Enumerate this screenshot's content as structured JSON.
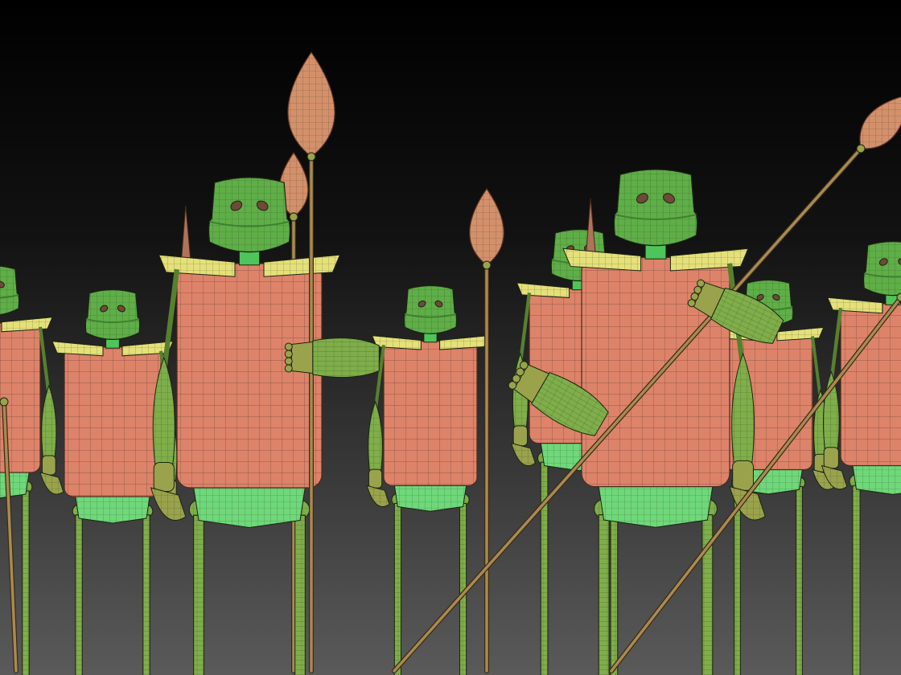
{
  "viewport": {
    "background_top": "#000000",
    "background_bottom": "#5a5a5a",
    "wire_color": "#1f2a14"
  },
  "palette": {
    "helmet": "#5fae48",
    "helmet_dark": "#3f7f30",
    "shoulder": "#e5e07a",
    "torso": "#dd836a",
    "skirt": "#6fd87a",
    "limb": "#7fae4a",
    "limb_dark": "#56802e",
    "hand": "#9aa24c",
    "spear_shaft": "#a88a52",
    "spear_tip": "#d3906a",
    "spike": "#b0735a",
    "eye": "#6e4a38"
  },
  "soldiers": [
    {
      "name": "soldier-far-left"
    },
    {
      "name": "soldier-left"
    },
    {
      "name": "soldier-front-left"
    },
    {
      "name": "soldier-center"
    },
    {
      "name": "soldier-center-right"
    },
    {
      "name": "soldier-front-right"
    },
    {
      "name": "soldier-right"
    },
    {
      "name": "soldier-far-right"
    }
  ],
  "spears": [
    {
      "name": "spear-vertical-left"
    },
    {
      "name": "spear-vertical-center"
    },
    {
      "name": "spear-diagonal-front"
    },
    {
      "name": "spear-diagonal-right"
    }
  ]
}
